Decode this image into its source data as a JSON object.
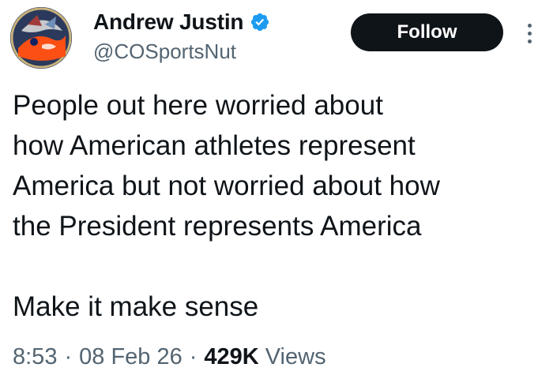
{
  "author": {
    "display_name": "Andrew Justin",
    "handle": "@COSportsNut",
    "verified": true,
    "verified_color": "#1d9bf0"
  },
  "actions": {
    "follow_label": "Follow",
    "more_icon": "more-vertical-icon"
  },
  "tweet": {
    "text": "People out here worried about\nhow American athletes represent\nAmerica but not worried about how\nthe President represents America\n\nMake it make sense"
  },
  "meta": {
    "time": "8:53",
    "separator": "·",
    "date": "08 Feb 26",
    "views_count": "429K",
    "views_label": "Views"
  }
}
